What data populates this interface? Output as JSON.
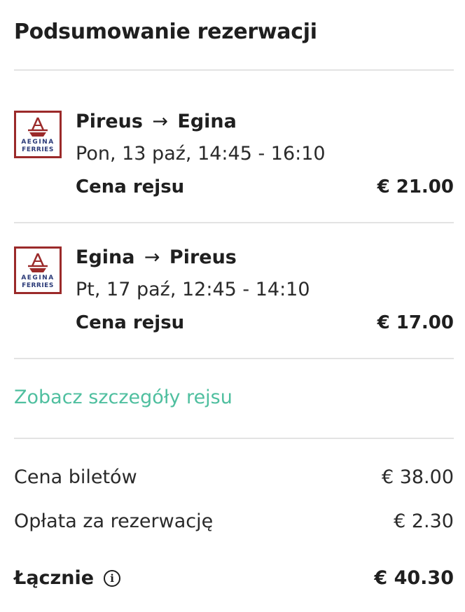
{
  "summary": {
    "title": "Podsumowanie rezerwacji"
  },
  "brand": {
    "logo_line1": "AEGINA",
    "logo_line2": "FERRIES",
    "logo_color": "#9b2a2a",
    "logo_text_color": "#2b3a78"
  },
  "trips": [
    {
      "from": "Pireus",
      "arrow": "→",
      "to": "Egina",
      "datetime": "Pon, 13 paź, 14:45 - 16:10",
      "price_label": "Cena rejsu",
      "price": "€ 21.00"
    },
    {
      "from": "Egina",
      "arrow": "→",
      "to": "Pireus",
      "datetime": "Pt, 17 paź, 12:45 - 14:10",
      "price_label": "Cena rejsu",
      "price": "€ 17.00"
    }
  ],
  "links": {
    "details": "Zobacz szczegóły rejsu",
    "accent_color": "#4fbf9f"
  },
  "totals": {
    "tickets_label": "Cena biletów",
    "tickets_value": "€ 38.00",
    "fee_label": "Opłata za rezerwację",
    "fee_value": "€ 2.30",
    "total_label": "Łącznie",
    "total_value": "€ 40.30",
    "info_icon": "info-icon"
  }
}
